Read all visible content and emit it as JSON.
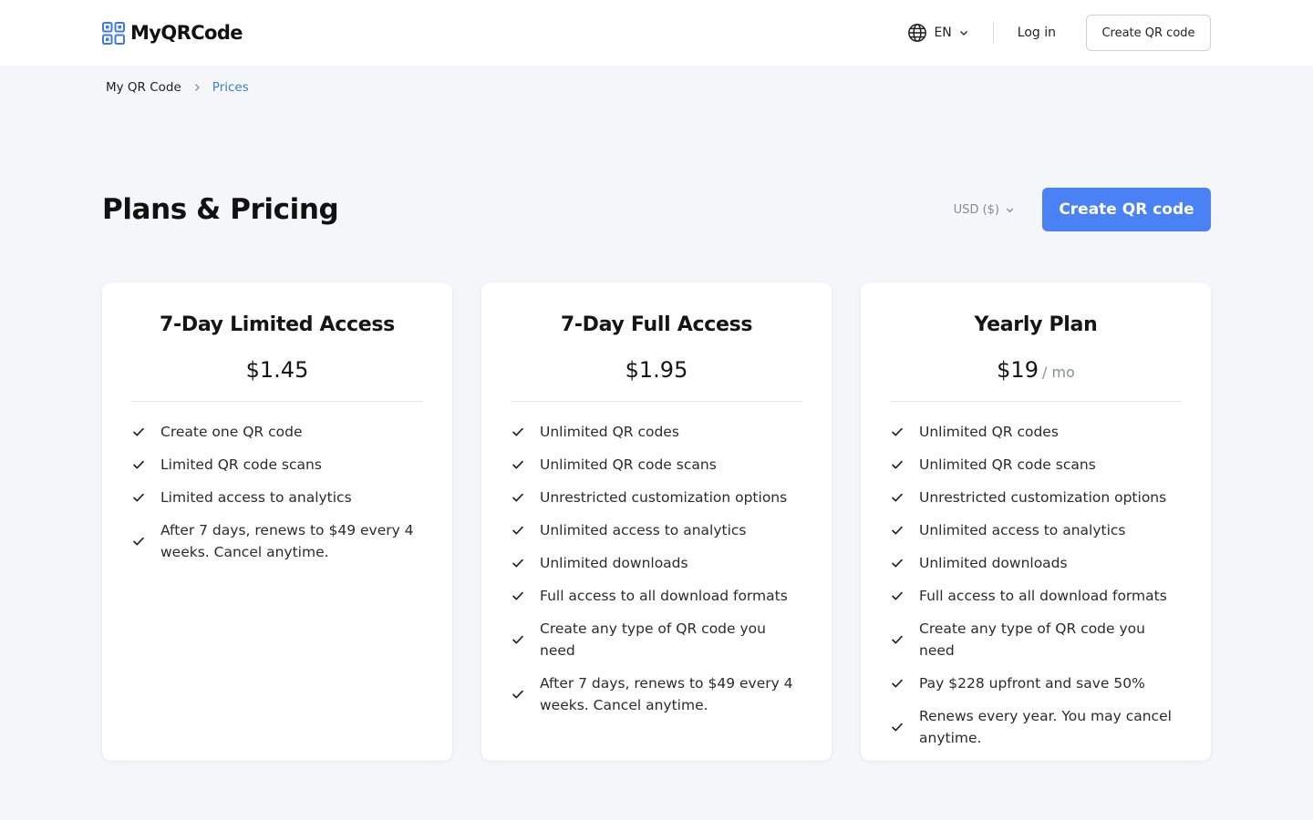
{
  "header": {
    "logo_text": "MyQRCode",
    "language": "EN",
    "login_label": "Log in",
    "create_label": "Create QR code"
  },
  "breadcrumb": {
    "home": "My QR Code",
    "current": "Prices"
  },
  "main": {
    "title": "Plans & Pricing",
    "currency": "USD ($)",
    "cta_label": "Create QR code"
  },
  "plans": [
    {
      "name": "7-Day Limited Access",
      "price": "$1.45",
      "features": [
        "Create one QR code",
        "Limited QR code scans",
        "Limited access to analytics",
        "After 7 days, renews to $49 every 4 weeks. Cancel anytime."
      ]
    },
    {
      "name": "7-Day Full Access",
      "price": "$1.95",
      "features": [
        "Unlimited QR codes",
        "Unlimited QR code scans",
        "Unrestricted customization options",
        "Unlimited access to analytics",
        "Unlimited downloads",
        "Full access to all download formats",
        "Create any type of QR code you need",
        "After 7 days, renews to $49 every 4 weeks. Cancel anytime."
      ]
    },
    {
      "name": "Yearly Plan",
      "price": "$19",
      "per": "/ mo",
      "features": [
        "Unlimited QR codes",
        "Unlimited QR code scans",
        "Unrestricted customization options",
        "Unlimited access to analytics",
        "Unlimited downloads",
        "Full access to all download formats",
        "Create any type of QR code you need",
        "Pay $228 upfront and save 50%",
        "Renews every year. You may cancel anytime."
      ]
    }
  ],
  "icons": {
    "logo": "qr-grid-icon",
    "language": "globe-icon",
    "dropdown": "chevron-down-icon",
    "breadcrumb_separator": "chevron-right-icon",
    "feature": "check-icon"
  },
  "colors": {
    "accent": "#4a82f5",
    "breadcrumb_current": "#3d7fd6",
    "page_background": "#f4f6fa",
    "logo_blue": "#3f7ae0"
  }
}
